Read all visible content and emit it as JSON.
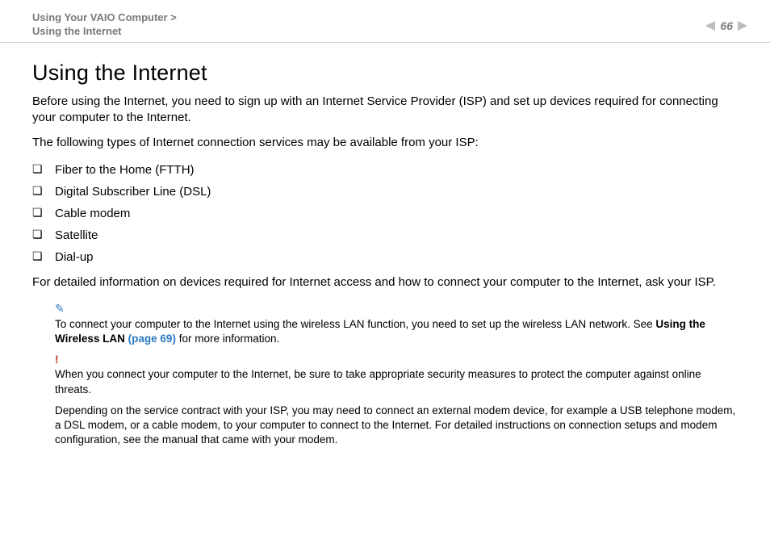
{
  "header": {
    "breadcrumb_line1": "Using Your VAIO Computer >",
    "breadcrumb_line2": "Using the Internet",
    "page_number": "66"
  },
  "main": {
    "title": "Using the Internet",
    "intro": "Before using the Internet, you need to sign up with an Internet Service Provider (ISP) and set up devices required for connecting your computer to the Internet.",
    "list_intro": "The following types of Internet connection services may be available from your ISP:",
    "items": [
      "Fiber to the Home (FTTH)",
      "Digital Subscriber Line (DSL)",
      "Cable modem",
      "Satellite",
      "Dial-up"
    ],
    "after_list": "For detailed information on devices required for Internet access and how to connect your computer to the Internet, ask your ISP.",
    "note1_pre": "To connect your computer to the Internet using the wireless LAN function, you need to set up the wireless LAN network. See ",
    "note1_link_bold": "Using the Wireless LAN (page 69)",
    "note1_post": " for more information.",
    "note2": "When you connect your computer to the Internet, be sure to take appropriate security measures to protect the computer against online threats.",
    "note3": "Depending on the service contract with your ISP, you may need to connect an external modem device, for example a USB telephone modem, a DSL modem, or a cable modem, to your computer to connect to the Internet. For detailed instructions on connection setups and modem configuration, see the manual that came with your modem."
  }
}
